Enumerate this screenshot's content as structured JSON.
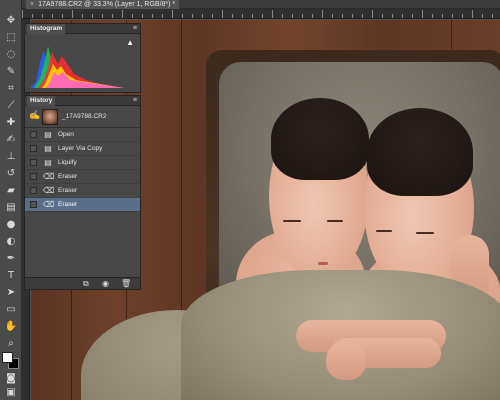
{
  "document_tab": {
    "close": "×",
    "title": "17A9788.CR2 @ 33.3% (Layer 1, RGB/8*) *"
  },
  "histogram_panel": {
    "tab_label": "Histogram",
    "menu_icon": "panel-menu-icon",
    "warning_icon": "▲"
  },
  "history_panel": {
    "tab_label": "History",
    "menu_icon": "panel-menu-icon",
    "snapshot": {
      "label": "_17A9788.CR2"
    },
    "states": [
      {
        "label": "Open",
        "icon": "document-icon"
      },
      {
        "label": "Layer Via Copy",
        "icon": "document-icon"
      },
      {
        "label": "Liquify",
        "icon": "document-icon"
      },
      {
        "label": "Eraser",
        "icon": "eraser-icon"
      },
      {
        "label": "Eraser",
        "icon": "eraser-icon"
      },
      {
        "label": "Eraser",
        "icon": "eraser-icon",
        "selected": true
      }
    ],
    "footer": [
      "new-document-from-state-icon",
      "camera-icon",
      "trash-icon"
    ]
  },
  "tools": [
    "move",
    "marquee",
    "lasso",
    "quick-select",
    "crop",
    "eyedropper",
    "healing",
    "brush",
    "clone-stamp",
    "history-brush",
    "eraser",
    "gradient",
    "blur",
    "dodge",
    "pen",
    "type",
    "path-select",
    "rectangle",
    "hand",
    "zoom"
  ],
  "colors": {
    "foreground": "#ffffff",
    "background": "#000000",
    "selection": "#5a6e8a",
    "panel": "#474747"
  }
}
